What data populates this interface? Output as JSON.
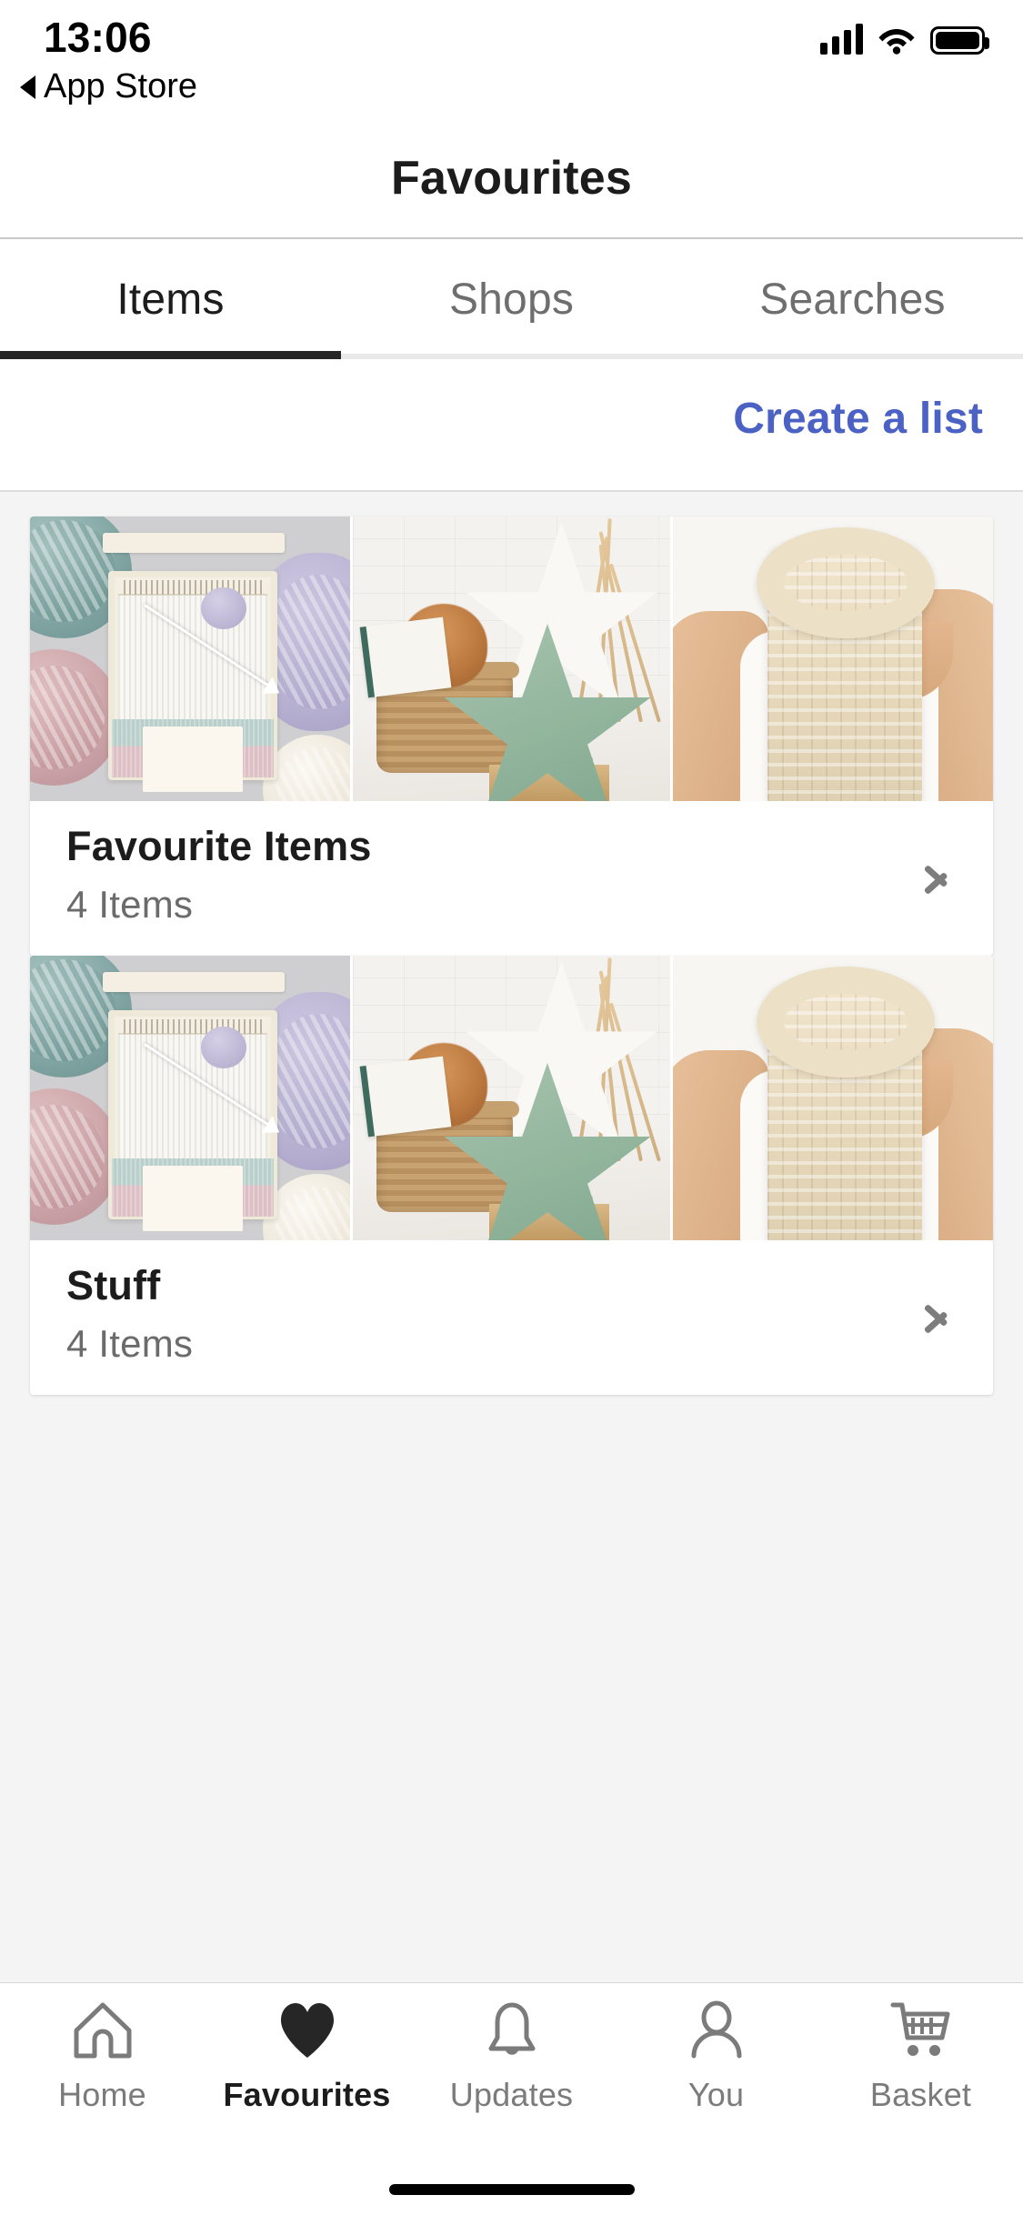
{
  "status_bar": {
    "time": "13:06",
    "back_label": "App Store",
    "signal_icon": "cellular-bars-icon",
    "wifi_icon": "wifi-icon",
    "battery_icon": "battery-full-icon"
  },
  "navbar": {
    "title": "Favourites"
  },
  "tabs": {
    "items": [
      {
        "label": "Items",
        "active": true
      },
      {
        "label": "Shops",
        "active": false
      },
      {
        "label": "Searches",
        "active": false
      }
    ],
    "active_index": 0,
    "active_color": "#262626",
    "inactive_color": "#6e6e6e"
  },
  "toolbar": {
    "create_list_label": "Create a list",
    "create_list_color": "#4b62c4"
  },
  "lists": [
    {
      "title": "Favourite Items",
      "subtitle": "4 Items",
      "chevron_icon": "chevron-right-icon",
      "thumbnails": [
        "weaving-loom-yarn-photo",
        "star-cushion-basket-photo",
        "cable-knit-scarf-photo"
      ]
    },
    {
      "title": "Stuff",
      "subtitle": "4 Items",
      "chevron_icon": "chevron-right-icon",
      "thumbnails": [
        "weaving-loom-yarn-photo",
        "star-cushion-basket-photo",
        "cable-knit-scarf-photo"
      ]
    }
  ],
  "tabbar": {
    "items": [
      {
        "label": "Home",
        "icon": "home-icon",
        "active": false
      },
      {
        "label": "Favourites",
        "icon": "heart-filled-icon",
        "active": true
      },
      {
        "label": "Updates",
        "icon": "bell-icon",
        "active": false
      },
      {
        "label": "You",
        "icon": "person-icon",
        "active": false
      },
      {
        "label": "Basket",
        "icon": "shopping-cart-icon",
        "active": false
      }
    ]
  }
}
